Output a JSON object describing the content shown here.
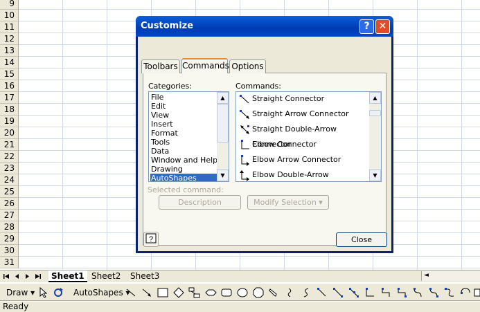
{
  "sheet": {
    "row_numbers": [
      "9",
      "10",
      "11",
      "12",
      "13",
      "14",
      "15",
      "16",
      "17",
      "18",
      "19",
      "20",
      "21",
      "22",
      "23",
      "24",
      "25",
      "26",
      "27",
      "28",
      "29",
      "30",
      "31"
    ],
    "tabs": [
      "Sheet1",
      "Sheet2",
      "Sheet3"
    ]
  },
  "dialog": {
    "title": "Customize",
    "help_glyph": "?",
    "close_glyph": "✕",
    "tabs": [
      "Toolbars",
      "Commands",
      "Options"
    ],
    "active_tab": "Commands",
    "categories_label": "Categories:",
    "categories": [
      "File",
      "Edit",
      "View",
      "Insert",
      "Format",
      "Tools",
      "Data",
      "Window and Help",
      "Drawing",
      "AutoShapes"
    ],
    "selected_category": "AutoShapes",
    "commands_label": "Commands:",
    "commands": [
      "Straight Connector",
      "Straight Arrow Connector",
      "Straight Double-Arrow Connector",
      "Elbow Connector",
      "Elbow Arrow Connector",
      "Elbow Double-Arrow Connector"
    ],
    "selected_command_label": "Selected command:",
    "description_button": "Description",
    "modify_selection_button": "Modify Selection ▾",
    "close_button": "Close"
  },
  "drawing_toolbar": {
    "draw_label": "Draw ▾",
    "autoshapes_label": "AutoShapes ▾"
  },
  "status": {
    "text": "Ready"
  },
  "colors": {
    "title_bar": "#0a5fd9",
    "selection": "#316ac5",
    "chrome": "#ece9d8"
  }
}
